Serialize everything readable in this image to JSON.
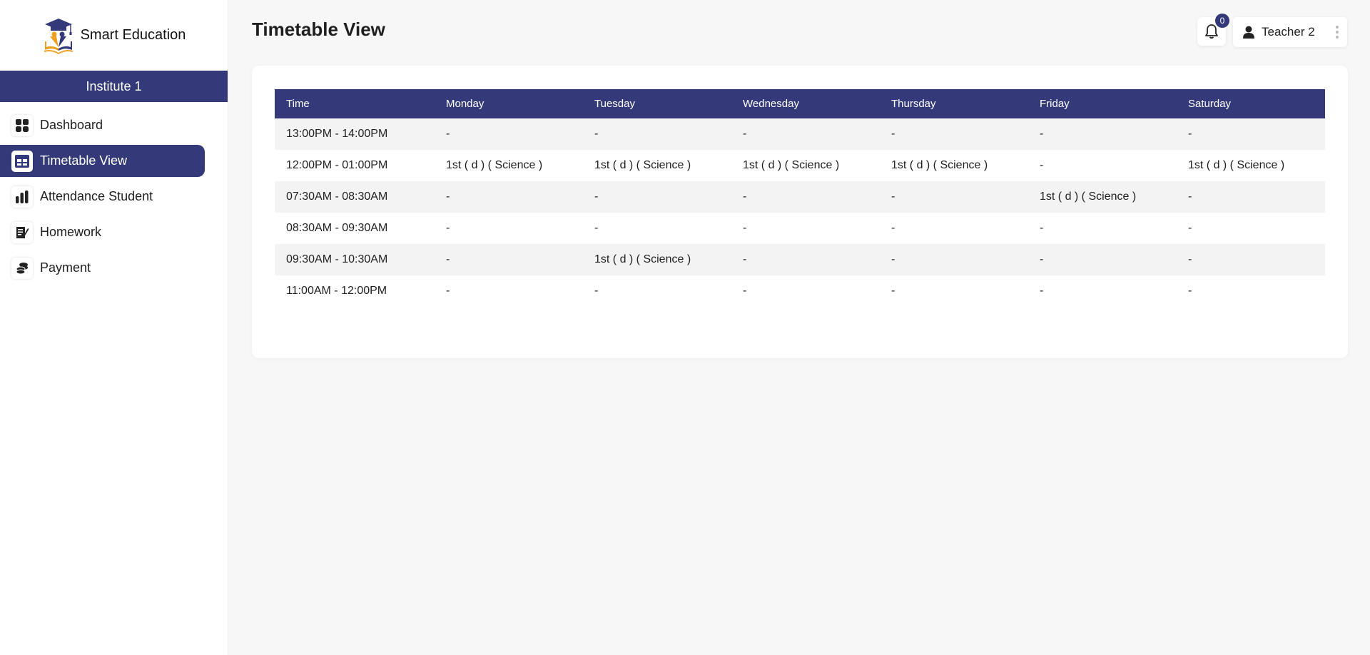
{
  "brand": {
    "name": "Smart Education",
    "logo_icon": "graduation-cap-book-logo"
  },
  "institute": "Institute 1",
  "sidebar": {
    "items": [
      {
        "label": "Dashboard",
        "icon": "grid-icon",
        "active": false
      },
      {
        "label": "Timetable View",
        "icon": "table-icon",
        "active": true
      },
      {
        "label": "Attendance Student",
        "icon": "bar-chart-icon",
        "active": false
      },
      {
        "label": "Homework",
        "icon": "notepad-pen-icon",
        "active": false
      },
      {
        "label": "Payment",
        "icon": "coins-icon",
        "active": false
      }
    ]
  },
  "header": {
    "title": "Timetable View",
    "notifications_count": "0",
    "user_name": "Teacher 2"
  },
  "colors": {
    "accent": "#343a79",
    "row_alt": "#f3f3f3",
    "background": "#f7f7f7"
  },
  "timetable": {
    "headers": [
      "Time",
      "Monday",
      "Tuesday",
      "Wednesday",
      "Thursday",
      "Friday",
      "Saturday"
    ],
    "rows": [
      [
        "13:00PM - 14:00PM",
        "-",
        "-",
        "-",
        "-",
        "-",
        "-"
      ],
      [
        "12:00PM - 01:00PM",
        "1st ( d ) ( Science )",
        "1st ( d ) ( Science )",
        "1st ( d ) ( Science )",
        "1st ( d ) ( Science )",
        "-",
        "1st ( d ) ( Science )"
      ],
      [
        "07:30AM - 08:30AM",
        "-",
        "-",
        "-",
        "-",
        "1st ( d ) ( Science )",
        "-"
      ],
      [
        "08:30AM - 09:30AM",
        "-",
        "-",
        "-",
        "-",
        "-",
        "-"
      ],
      [
        "09:30AM - 10:30AM",
        "-",
        "1st ( d ) ( Science )",
        "-",
        "-",
        "-",
        "-"
      ],
      [
        "11:00AM - 12:00PM",
        "-",
        "-",
        "-",
        "-",
        "-",
        "-"
      ]
    ]
  }
}
